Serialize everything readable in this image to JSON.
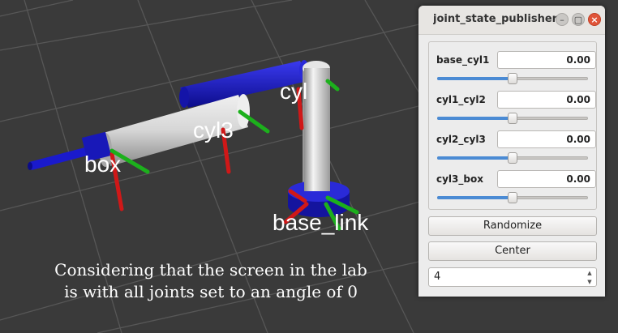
{
  "scene": {
    "frame_labels": [
      "box",
      "cyl3",
      "cyl",
      "base_link"
    ],
    "colors": {
      "background": "#3a3a3a",
      "grid": "#5a5a5a",
      "link_blue": "#1a1acc",
      "cylinder_gray": "#c8c8c8",
      "axis_red": "#d01818",
      "axis_green": "#1cb01c"
    }
  },
  "caption": {
    "line1": "Considering that the screen in the lab",
    "line2": "is with all joints set to an angle of 0"
  },
  "window": {
    "title": "joint_state_publisher",
    "min_glyph": "–",
    "max_glyph": "▢",
    "close_glyph": "×"
  },
  "joints": [
    {
      "name": "base_cyl1",
      "value": "0.00",
      "slider_fraction": 0.5
    },
    {
      "name": "cyl1_cyl2",
      "value": "0.00",
      "slider_fraction": 0.5
    },
    {
      "name": "cyl2_cyl3",
      "value": "0.00",
      "slider_fraction": 0.5
    },
    {
      "name": "cyl3_box",
      "value": "0.00",
      "slider_fraction": 0.5
    }
  ],
  "buttons": {
    "randomize": "Randomize",
    "center": "Center"
  },
  "spinbox": {
    "value": "4",
    "up_glyph": "▲",
    "down_glyph": "▼"
  }
}
